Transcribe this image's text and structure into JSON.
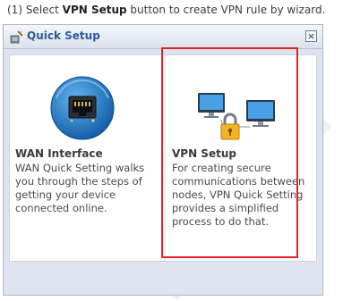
{
  "instruction": {
    "prefix": "(1) Select ",
    "bold": "VPN Setup",
    "suffix": " button to create VPN rule by wizard."
  },
  "dialog": {
    "title": "Quick Setup",
    "close_glyph": "×",
    "title_icon": "wizard-icon"
  },
  "panels": {
    "wan": {
      "title": "WAN Interface",
      "description": "WAN Quick Setting walks you through the steps of getting your device connected online.",
      "icon": "ethernet-port-icon"
    },
    "vpn": {
      "title": "VPN Setup",
      "description": "For creating secure communications between nodes, VPN Quick Setting provides a simplified process to do that.",
      "icon": "vpn-computers-lock-icon"
    }
  },
  "colors": {
    "title_blue": "#2a5b9a",
    "highlight_red": "#e2232a",
    "wan_globe": "#1f78c8"
  }
}
